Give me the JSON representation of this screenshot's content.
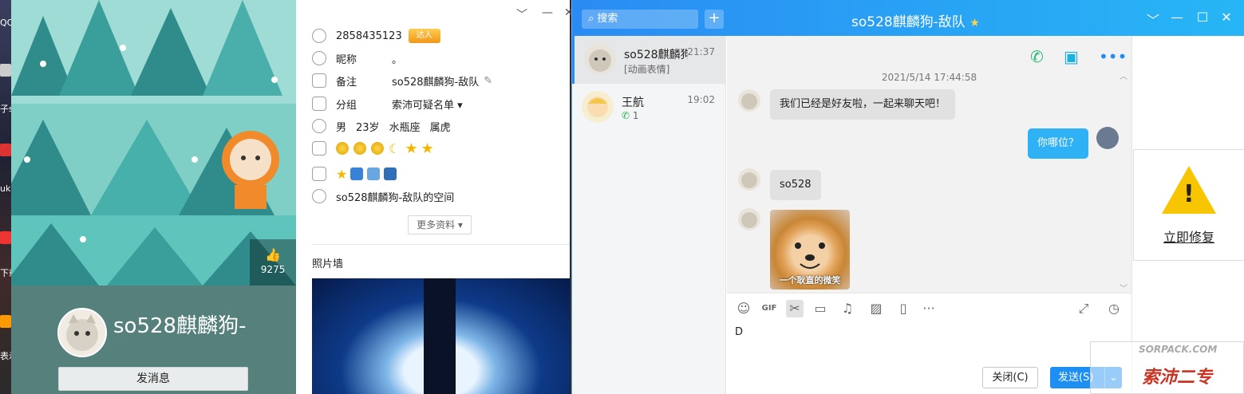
{
  "desktop": {
    "labels": [
      "QQ",
      "子s",
      "uk",
      "下载",
      "表示"
    ]
  },
  "profile": {
    "like_count": "9275",
    "display_name": "so528麒麟狗-",
    "send_message": "发消息",
    "qq_number": "2858435123",
    "badge": "达人",
    "nickname_label": "昵称",
    "nickname_value": "。",
    "remark_label": "备注",
    "remark_value": "so528麒麟狗-敌队",
    "group_label": "分组",
    "group_value": "索沛可疑名单 ▾",
    "gender": "男",
    "age": "23岁",
    "zodiac": "水瓶座",
    "animal": "属虎",
    "space_link": "so528麒麟狗-敌队的空间",
    "more_info": "更多资料 ▾",
    "photo_wall": "照片墙"
  },
  "chat": {
    "search_placeholder": "搜索",
    "title": "so528麒麟狗-敌队",
    "title_star": "★",
    "contacts": [
      {
        "name": "so528麒麟狗",
        "time": "21:37",
        "sub": "[动画表情]"
      },
      {
        "name": "王航",
        "time": "19:02",
        "sub": "1"
      }
    ],
    "timestamp": "2021/5/14 17:44:58",
    "messages": [
      {
        "from": "them",
        "text": "我们已经是好友啦，一起来聊天吧！"
      },
      {
        "from": "me",
        "text": "你哪位？"
      },
      {
        "from": "them",
        "text": "so528"
      },
      {
        "from": "them",
        "sticker_caption": "一个耿直的微笑"
      }
    ],
    "input_text": "D",
    "close_label": "关闭(C)",
    "send_label": "发送(S)"
  },
  "repair": {
    "link": "立即修复"
  },
  "watermark": {
    "line1": "SORPACK.COM",
    "line2": "索沛二专"
  },
  "colors": {
    "accent": "#2a8cf3",
    "my_bubble": "#2fb2f5",
    "warning": "#f7c600"
  }
}
